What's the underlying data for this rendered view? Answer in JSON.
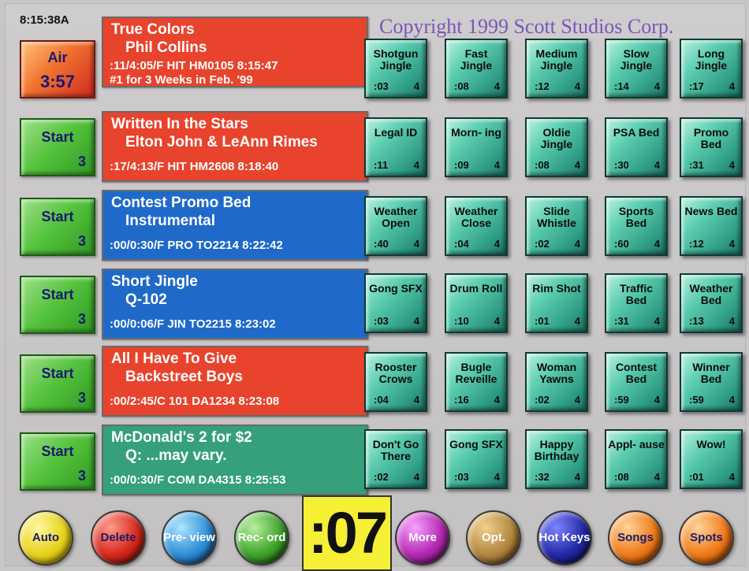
{
  "header": {
    "clock": "8:15:38A",
    "copyright": "Copyright 1999 Scott Studios Corp."
  },
  "decks": [
    {
      "button": {
        "l1": "Air",
        "l2": "3:57"
      },
      "title": "True Colors",
      "artist": "Phil Collins",
      "meta": ":11/4:05/F  HIT HM0105  8:15:47",
      "note": "#1 for 3 Weeks in Feb. '99",
      "color": "#e8432c"
    },
    {
      "button": {
        "l1": "Start",
        "l2": "3"
      },
      "title": "Written In the Stars",
      "artist": "Elton John & LeAnn Rimes",
      "meta": ":17/4:13/F  HIT  HM2608 8:18:40",
      "note": "",
      "color": "#e8432c"
    },
    {
      "button": {
        "l1": "Start",
        "l2": "3"
      },
      "title": "Contest Promo Bed",
      "artist": "Instrumental",
      "meta": ":00/0:30/F  PRO TO2214 8:22:42",
      "note": "",
      "color": "#1f6ac9"
    },
    {
      "button": {
        "l1": "Start",
        "l2": "3"
      },
      "title": "Short Jingle",
      "artist": "Q-102",
      "meta": ":00/0:06/F  JIN TO2215 8:23:02",
      "note": "",
      "color": "#1f6ac9"
    },
    {
      "button": {
        "l1": "Start",
        "l2": "3"
      },
      "title": "All I Have To Give",
      "artist": "Backstreet Boys",
      "meta": ":00/2:45/C  101 DA1234 8:23:08",
      "note": "",
      "color": "#e8432c"
    },
    {
      "button": {
        "l1": "Start",
        "l2": "3"
      },
      "title": "McDonald's 2 for $2",
      "artist": "Q:  ...may vary.",
      "meta": ":00/0:30/F  COM DA4315 8:25:53",
      "note": "",
      "color": "#35a07a"
    }
  ],
  "hotkeys": [
    [
      {
        "name": "Shotgun Jingle",
        "len": ":03",
        "num": "4"
      },
      {
        "name": "Fast Jingle",
        "len": ":08",
        "num": "4"
      },
      {
        "name": "Medium Jingle",
        "len": ":12",
        "num": "4"
      },
      {
        "name": "Slow Jingle",
        "len": ":14",
        "num": "4"
      },
      {
        "name": "Long Jingle",
        "len": ":17",
        "num": "4"
      }
    ],
    [
      {
        "name": "Legal ID",
        "len": ":11",
        "num": "4"
      },
      {
        "name": "Morn- ing",
        "len": ":09",
        "num": "4"
      },
      {
        "name": "Oldie Jingle",
        "len": ":08",
        "num": "4"
      },
      {
        "name": "PSA Bed",
        "len": ":30",
        "num": "4"
      },
      {
        "name": "Promo Bed",
        "len": ":31",
        "num": "4"
      }
    ],
    [
      {
        "name": "Weather Open",
        "len": ":40",
        "num": "4"
      },
      {
        "name": "Weather Close",
        "len": ":04",
        "num": "4"
      },
      {
        "name": "Slide Whistle",
        "len": ":02",
        "num": "4"
      },
      {
        "name": "Sports Bed",
        "len": ":60",
        "num": "4"
      },
      {
        "name": "News Bed",
        "len": ":12",
        "num": "4"
      }
    ],
    [
      {
        "name": "Gong SFX",
        "len": ":03",
        "num": "4"
      },
      {
        "name": "Drum Roll",
        "len": ":10",
        "num": "4"
      },
      {
        "name": "Rim Shot",
        "len": ":01",
        "num": "4"
      },
      {
        "name": "Traffic Bed",
        "len": ":31",
        "num": "4"
      },
      {
        "name": "Weather Bed",
        "len": ":13",
        "num": "4"
      }
    ],
    [
      {
        "name": "Rooster Crows",
        "len": ":04",
        "num": "4"
      },
      {
        "name": "Bugle Reveille",
        "len": ":16",
        "num": "4"
      },
      {
        "name": "Woman Yawns",
        "len": ":02",
        "num": "4"
      },
      {
        "name": "Contest Bed",
        "len": ":59",
        "num": "4"
      },
      {
        "name": "Winner Bed",
        "len": ":59",
        "num": "4"
      }
    ],
    [
      {
        "name": "Don't Go There",
        "len": ":02",
        "num": "4"
      },
      {
        "name": "Gong SFX",
        "len": ":03",
        "num": "4"
      },
      {
        "name": "Happy Birthday",
        "len": ":32",
        "num": "4"
      },
      {
        "name": "Appl- ause",
        "len": ":08",
        "num": "4"
      },
      {
        "name": "Wow!",
        "len": ":01",
        "num": "4"
      }
    ]
  ],
  "bottom": {
    "auto": "Auto",
    "delete": "Delete",
    "preview": "Pre- view",
    "record": "Rec- ord",
    "counter": ":07",
    "more": "More",
    "opt": "Opt.",
    "hotkeys": "Hot Keys",
    "songs": "Songs",
    "spots": "Spots"
  },
  "colors": {
    "red_cart": "#e8432c",
    "blue_cart": "#1f6ac9",
    "green_cart": "#35a07a",
    "counter_bg": "#f5ef36"
  }
}
